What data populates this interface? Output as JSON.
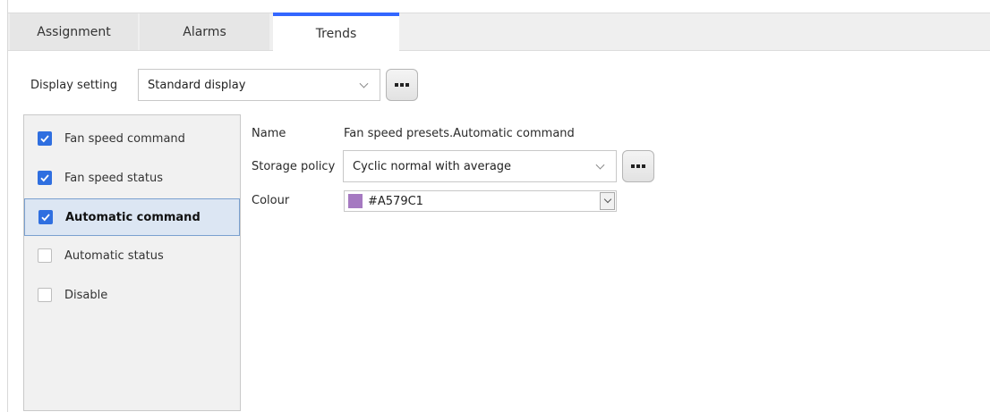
{
  "tabs": [
    {
      "label": "Assignment",
      "active": false
    },
    {
      "label": "Alarms",
      "active": false
    },
    {
      "label": "Trends",
      "active": true
    }
  ],
  "accent_color": "#3366ff",
  "display_setting": {
    "label": "Display setting",
    "value": "Standard display",
    "more_icon": "ellipsis-icon"
  },
  "trend_list": [
    {
      "label": "Fan speed command",
      "checked": true,
      "selected": false
    },
    {
      "label": "Fan speed status",
      "checked": true,
      "selected": false
    },
    {
      "label": "Automatic command",
      "checked": true,
      "selected": true
    },
    {
      "label": "Automatic status",
      "checked": false,
      "selected": false
    },
    {
      "label": "Disable",
      "checked": false,
      "selected": false
    }
  ],
  "details": {
    "name_label": "Name",
    "name_value": "Fan speed presets.Automatic command",
    "storage_label": "Storage policy",
    "storage_value": "Cyclic normal with average",
    "colour_label": "Colour",
    "colour_value": "#A579C1"
  }
}
